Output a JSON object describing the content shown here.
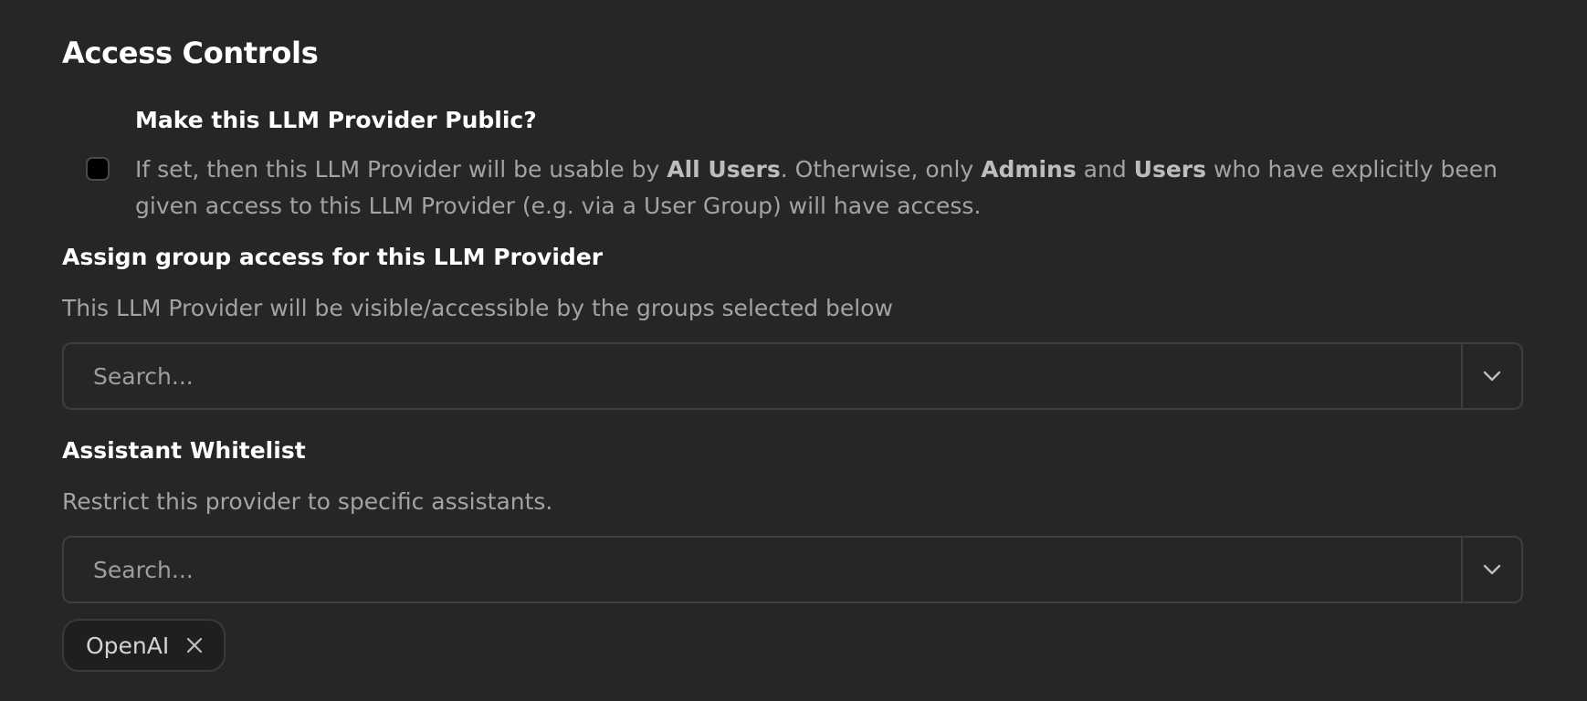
{
  "section": {
    "title": "Access Controls"
  },
  "public_option": {
    "title": "Make this LLM Provider Public?",
    "checked": false,
    "desc_part1": "If set, then this LLM Provider will be usable by ",
    "desc_bold1": "All Users",
    "desc_part2": ". Otherwise, only ",
    "desc_bold2": "Admins",
    "desc_part3": " and ",
    "desc_bold3": "Users",
    "desc_part4": " who have explicitly been given access to this LLM Provider (e.g. via a User Group) will have access."
  },
  "group_access": {
    "label": "Assign group access for this LLM Provider",
    "description": "This LLM Provider will be visible/accessible by the groups selected below",
    "placeholder": "Search...",
    "toggle_icon": "chevron-down-icon"
  },
  "assistant_whitelist": {
    "label": "Assistant Whitelist",
    "description": "Restrict this provider to specific assistants.",
    "placeholder": "Search...",
    "toggle_icon": "chevron-down-icon",
    "selected": [
      {
        "label": "OpenAI",
        "remove_icon": "close-icon"
      }
    ]
  },
  "colors": {
    "background": "#262626",
    "text_primary": "#ffffff",
    "text_muted": "#a3a3a3",
    "border": "#3f3f3f"
  }
}
